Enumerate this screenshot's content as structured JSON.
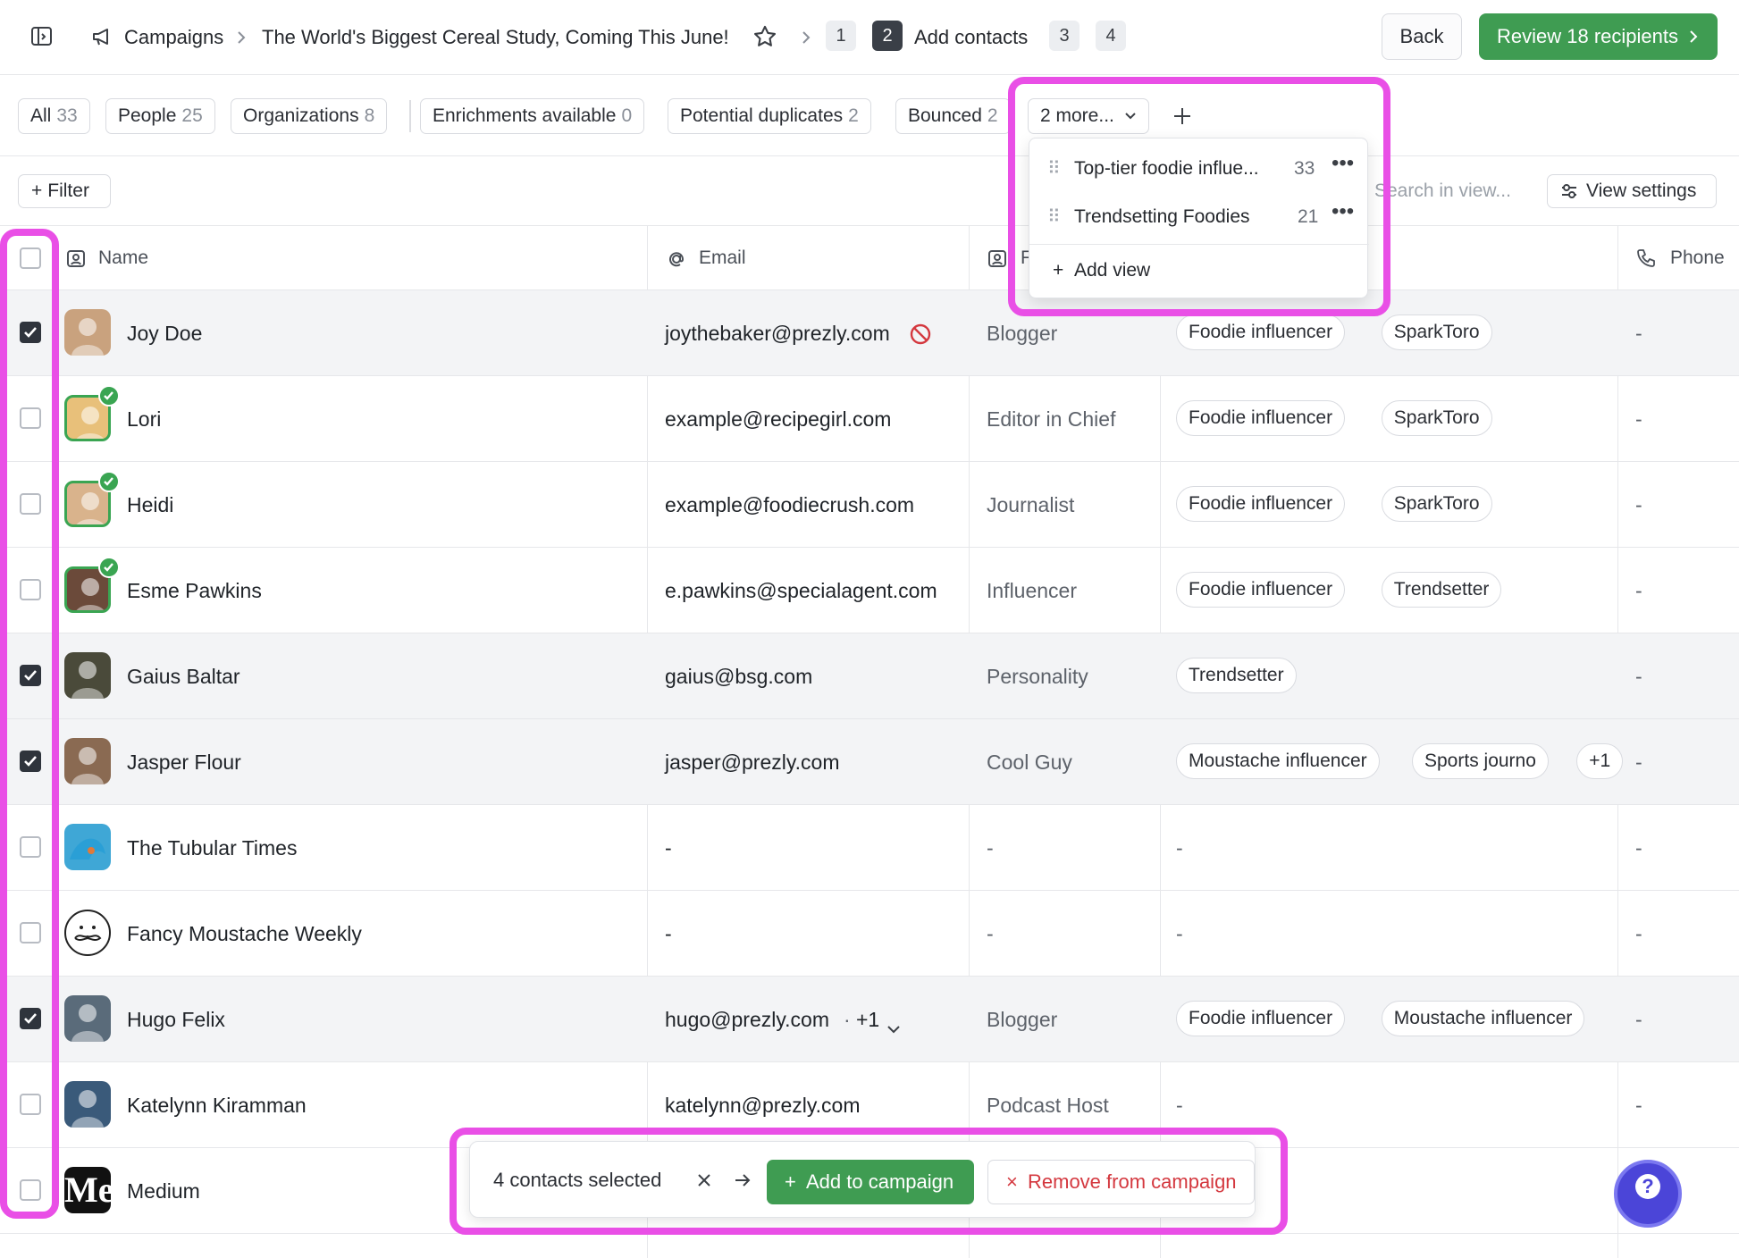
{
  "header": {
    "breadcrumb": [
      "Campaigns",
      "The World's Biggest Cereal Study, Coming This June!"
    ],
    "steps": [
      "1",
      "2",
      "3",
      "4"
    ],
    "active_step_label": "Add contacts",
    "back_label": "Back",
    "review_label": "Review 18 recipients"
  },
  "views": {
    "tabs": [
      {
        "label": "All",
        "count": "33"
      },
      {
        "label": "People",
        "count": "25"
      },
      {
        "label": "Organizations",
        "count": "8"
      },
      {
        "label": "Enrichments available",
        "count": "0"
      },
      {
        "label": "Potential duplicates",
        "count": "2"
      },
      {
        "label": "Bounced",
        "count": "2"
      }
    ],
    "more_label": "2 more...",
    "menu_items": [
      {
        "label": "Top-tier foodie influe...",
        "count": "33"
      },
      {
        "label": "Trendsetting Foodies",
        "count": "21"
      }
    ],
    "add_view_label": "Add view"
  },
  "toolbar": {
    "filter_label": "Filter",
    "search_placeholder": "Search in view...",
    "view_settings_label": "View settings"
  },
  "columns": {
    "name": "Name",
    "email": "Email",
    "role_partial": "F",
    "phone": "Phone"
  },
  "rows": [
    {
      "name": "Joy Doe",
      "email": "joythebaker@prezly.com",
      "role": "Blogger",
      "tags": [
        "Foodie influencer",
        "SparkToro"
      ],
      "phone": "-",
      "checked": true,
      "verified": false,
      "bounced": true
    },
    {
      "name": "Lori",
      "email": "example@recipegirl.com",
      "role": "Editor in Chief",
      "tags": [
        "Foodie influencer",
        "SparkToro"
      ],
      "phone": "-",
      "checked": false,
      "verified": true
    },
    {
      "name": "Heidi",
      "email": "example@foodiecrush.com",
      "role": "Journalist",
      "tags": [
        "Foodie influencer",
        "SparkToro"
      ],
      "phone": "-",
      "checked": false,
      "verified": true
    },
    {
      "name": "Esme Pawkins",
      "email": "e.pawkins@specialagent.com",
      "role": "Influencer",
      "tags": [
        "Foodie influencer",
        "Trendsetter"
      ],
      "phone": "-",
      "checked": false,
      "verified": true
    },
    {
      "name": "Gaius Baltar",
      "email": "gaius@bsg.com",
      "role": "Personality",
      "tags": [
        "Trendsetter"
      ],
      "phone": "-",
      "checked": true,
      "verified": false
    },
    {
      "name": "Jasper Flour",
      "email": "jasper@prezly.com",
      "role": "Cool Guy",
      "tags": [
        "Moustache influencer",
        "Sports journo",
        "+1"
      ],
      "phone": "-",
      "checked": true,
      "verified": false
    },
    {
      "name": "The Tubular Times",
      "email": "-",
      "role": "-",
      "tags_text": "-",
      "tags": [],
      "phone": "-",
      "checked": false,
      "verified": false
    },
    {
      "name": "Fancy Moustache Weekly",
      "email": "-",
      "role": "-",
      "tags_text": "-",
      "tags": [],
      "phone": "-",
      "checked": false,
      "verified": false
    },
    {
      "name": "Hugo Felix",
      "email": "hugo@prezly.com",
      "email_extra": "+1",
      "role": "Blogger",
      "tags": [
        "Foodie influencer",
        "Moustache influencer"
      ],
      "phone": "-",
      "checked": true,
      "verified": false
    },
    {
      "name": "Katelynn Kiramman",
      "email": "katelynn@prezly.com",
      "role": "Podcast Host",
      "tags_text": "-",
      "tags": [],
      "phone": "-",
      "checked": false,
      "verified": false
    },
    {
      "name": "Medium",
      "avatar_text": "Me",
      "email": "",
      "role": "",
      "tags": [],
      "phone": "",
      "checked": false,
      "verified": false
    }
  ],
  "bulk": {
    "selected_label": "4 contacts selected",
    "add_label": "Add to campaign",
    "remove_label": "Remove from campaign"
  },
  "help_label": "?",
  "colors": {
    "accent_green": "#3f9c52",
    "highlight": "#e94fe6",
    "danger": "#d4383f",
    "help": "#4b45d8"
  }
}
